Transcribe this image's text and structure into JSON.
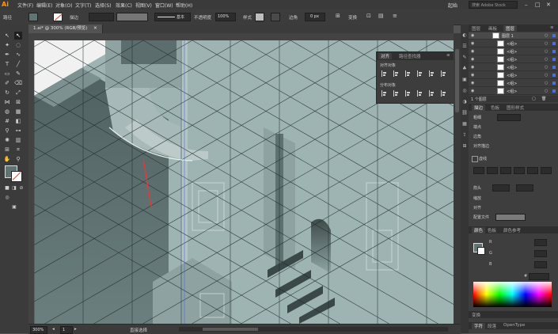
{
  "app": {
    "logo": "Ai"
  },
  "menu": [
    "文件(F)",
    "编辑(E)",
    "对象(O)",
    "文字(T)",
    "选择(S)",
    "效果(C)",
    "视图(V)",
    "窗口(W)",
    "帮助(H)"
  ],
  "workspace": "起始",
  "search_placeholder": "搜索 Adobe Stock",
  "control": {
    "left_label": "路径",
    "stroke_label": "描边",
    "stroke_value": "",
    "style_line": "基本",
    "opacity_label": "不透明度",
    "opacity_value": "100%",
    "style_label": "样式",
    "corner_label": "边角",
    "corner_value": "0 px",
    "transform_label": "变换"
  },
  "document_tab": "1.ai* @ 300% (RGB/预览)",
  "status": {
    "zoom": "300%",
    "artboard": "1",
    "tool_status": "直接选择"
  },
  "align_panel": {
    "tabs": [
      "对齐",
      "路径查找器"
    ],
    "section1": "对齐对象",
    "section2": "分布对象"
  },
  "layers_panel": {
    "tabs": [
      "图层",
      "画板",
      "图层"
    ],
    "active_tab": "图层",
    "rows": [
      "图层 1",
      "<组>",
      "<组>",
      "<组>",
      "<组>",
      "<组>",
      "<组>",
      "<组>"
    ],
    "footer": "1 个图层"
  },
  "props_panel": {
    "tabs": [
      "描边",
      "色板",
      "图形样式"
    ],
    "weight_label": "粗细",
    "cap_label": "端点",
    "corner_label": "边角",
    "limit_label": "限制",
    "align_label": "对齐描边",
    "dashed_label": "虚线",
    "arrow_label": "箭头",
    "scale_label": "缩放",
    "align2_label": "对齐",
    "profile_label": "配置文件"
  },
  "color_panel": {
    "tabs": [
      "颜色",
      "色板",
      "颜色参考"
    ],
    "labels": [
      "R",
      "G",
      "B"
    ],
    "hex_label": "#"
  },
  "bottom_panels": {
    "transform": "变换",
    "char_tabs": [
      "字符",
      "段落",
      "OpenType"
    ]
  },
  "colors": {
    "accent": "#ff9a00",
    "floor": "#9db4b3",
    "wall_dark": "#5d7170",
    "selection_red": "#e33a3a"
  }
}
